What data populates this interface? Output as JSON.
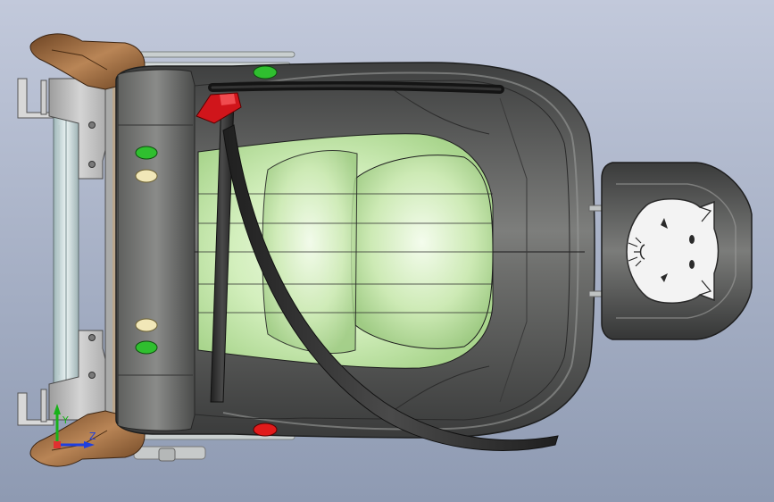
{
  "viewport": {
    "background_top": "#c2c9db",
    "background_bottom": "#8e9ab2"
  },
  "model": {
    "seat_shell_color": "#4f5050",
    "cushion_color": "#d6f0c2",
    "belt_color": "#2b2b2b",
    "bracket_color": "#b9b9b9",
    "trim_color": "#9c6b3f",
    "latch_color": "#d0151b"
  },
  "indicators": {
    "green": "#2fbf2f",
    "cream": "#f1e7b8",
    "red": "#e11b1b"
  },
  "triad": {
    "y_axis_label": "Y",
    "z_axis_label": "Z",
    "y_axis_color": "#19b219",
    "z_axis_color": "#1e3fe0"
  },
  "headrest": {
    "emblem": "cat-face-icon"
  }
}
